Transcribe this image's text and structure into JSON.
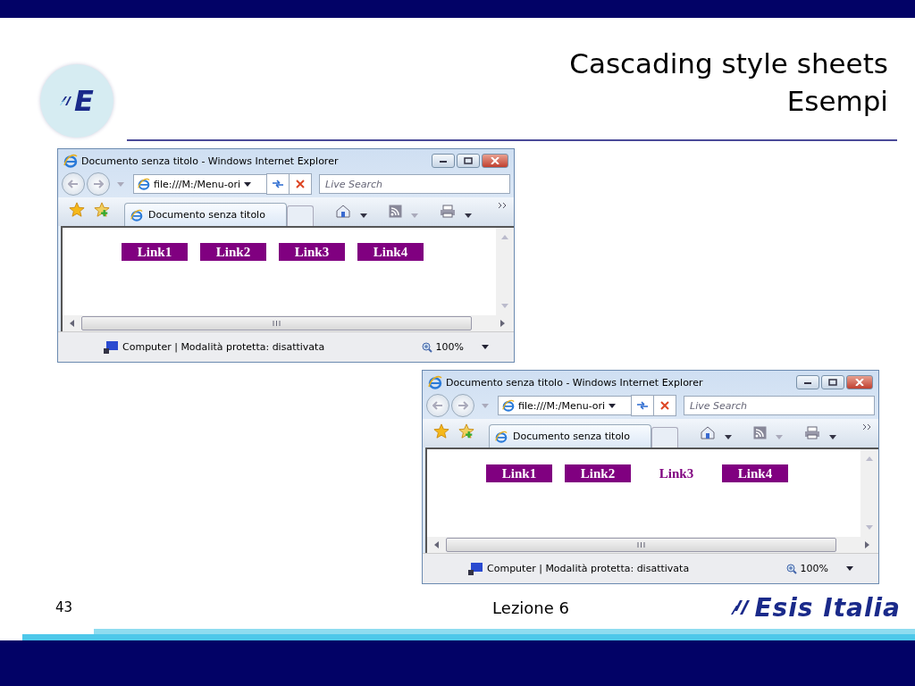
{
  "slide": {
    "title": "Cascading style sheets",
    "subtitle": "Esempi",
    "logo_letter": "E",
    "page_number": "43",
    "footer": "Lezione 6",
    "brand": "Esis Italia"
  },
  "browsers": [
    {
      "title": "Documento senza titolo - Windows Internet Explorer",
      "address": "file:///M:/Menu-ori",
      "search_placeholder": "Live Search",
      "tab": "Documento senza titolo",
      "links": [
        {
          "label": "Link1",
          "hovered": false
        },
        {
          "label": "Link2",
          "hovered": false
        },
        {
          "label": "Link3",
          "hovered": false
        },
        {
          "label": "Link4",
          "hovered": false
        }
      ],
      "status": "Computer | Modalità protetta: disattivata",
      "zoom": "100%"
    },
    {
      "title": "Documento senza titolo - Windows Internet Explorer",
      "address": "file:///M:/Menu-ori",
      "search_placeholder": "Live Search",
      "tab": "Documento senza titolo",
      "links": [
        {
          "label": "Link1",
          "hovered": false
        },
        {
          "label": "Link2",
          "hovered": false
        },
        {
          "label": "Link3",
          "hovered": true
        },
        {
          "label": "Link4",
          "hovered": false
        }
      ],
      "status": "Computer | Modalità protetta: disattivata",
      "zoom": "100%"
    }
  ]
}
